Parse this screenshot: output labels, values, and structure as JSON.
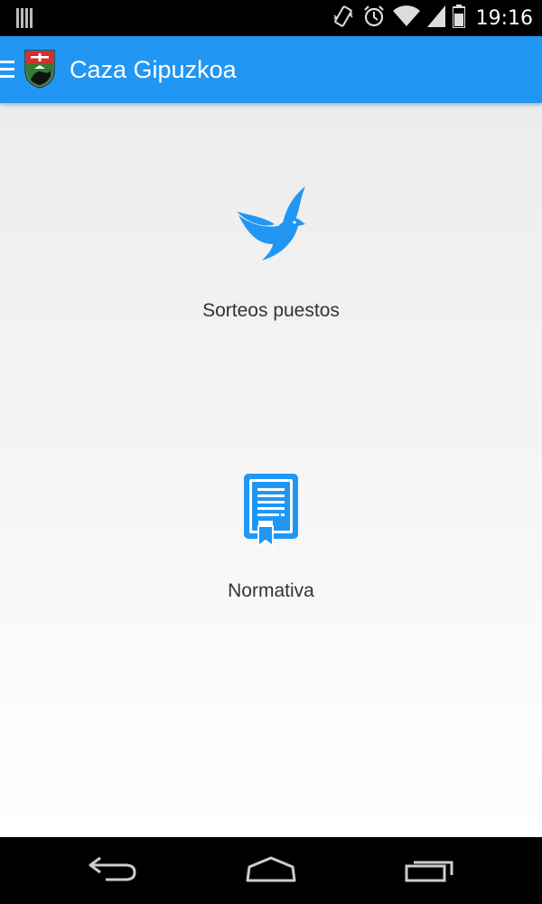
{
  "status_bar": {
    "time": "19:16",
    "icons": [
      "notification-icon",
      "vibrate-icon",
      "alarm-icon",
      "wifi-icon",
      "signal-icon",
      "battery-icon"
    ]
  },
  "app_bar": {
    "title": "Caza Gipuzkoa",
    "color": "#2196F3"
  },
  "menu": {
    "items": [
      {
        "label": "Sorteos puestos",
        "icon": "dove-icon"
      },
      {
        "label": "Normativa",
        "icon": "certificate-icon"
      }
    ],
    "accent": "#2196F3"
  },
  "nav_bar": {
    "buttons": [
      "back-icon",
      "home-icon",
      "recents-icon"
    ]
  }
}
